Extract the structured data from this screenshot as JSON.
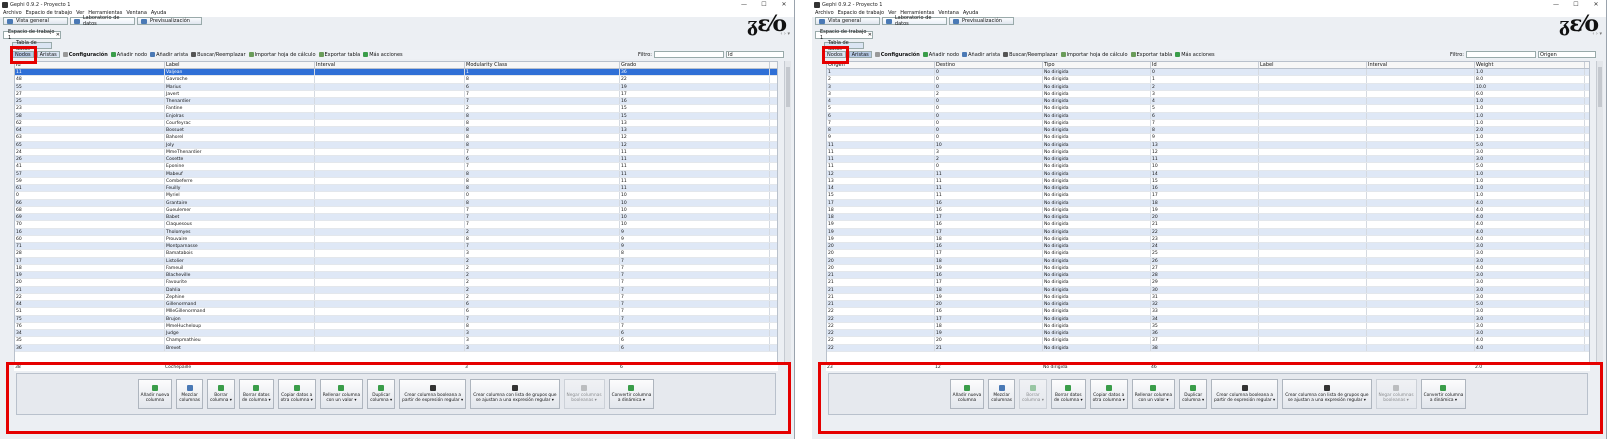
{
  "windows": [
    {
      "id": "left",
      "title": "Gephi 0.9.2 - Proyecto 1",
      "active_view": "Nodos",
      "columns": [
        "Id",
        "Label",
        "Interval",
        "Modularity Class",
        "Grado"
      ],
      "col_widths": [
        150,
        150,
        150,
        155,
        150
      ],
      "rows": [
        [
          "11",
          "Valjean",
          "",
          "1",
          "36"
        ],
        [
          "48",
          "Gavroche",
          "",
          "8",
          "22"
        ],
        [
          "55",
          "Marius",
          "",
          "6",
          "19"
        ],
        [
          "27",
          "Javert",
          "",
          "7",
          "17"
        ],
        [
          "25",
          "Thenardier",
          "",
          "7",
          "16"
        ],
        [
          "23",
          "Fantine",
          "",
          "2",
          "15"
        ],
        [
          "58",
          "Enjolras",
          "",
          "8",
          "15"
        ],
        [
          "62",
          "Courfeyrac",
          "",
          "8",
          "13"
        ],
        [
          "64",
          "Bossuet",
          "",
          "8",
          "13"
        ],
        [
          "63",
          "Bahorel",
          "",
          "8",
          "12"
        ],
        [
          "65",
          "Joly",
          "",
          "8",
          "12"
        ],
        [
          "24",
          "MmeThenardier",
          "",
          "7",
          "11"
        ],
        [
          "26",
          "Cosette",
          "",
          "6",
          "11"
        ],
        [
          "41",
          "Eponine",
          "",
          "7",
          "11"
        ],
        [
          "57",
          "Mabeuf",
          "",
          "8",
          "11"
        ],
        [
          "59",
          "Combeferre",
          "",
          "8",
          "11"
        ],
        [
          "61",
          "Feuilly",
          "",
          "8",
          "11"
        ],
        [
          "0",
          "Myriel",
          "",
          "0",
          "10"
        ],
        [
          "66",
          "Grantaire",
          "",
          "8",
          "10"
        ],
        [
          "68",
          "Gueulemer",
          "",
          "7",
          "10"
        ],
        [
          "69",
          "Babet",
          "",
          "7",
          "10"
        ],
        [
          "70",
          "Claquesous",
          "",
          "7",
          "10"
        ],
        [
          "16",
          "Tholomyes",
          "",
          "2",
          "9"
        ],
        [
          "60",
          "Prouvaire",
          "",
          "8",
          "9"
        ],
        [
          "71",
          "Montparnasse",
          "",
          "7",
          "9"
        ],
        [
          "28",
          "Bamatabois",
          "",
          "3",
          "8"
        ],
        [
          "17",
          "Listolier",
          "",
          "2",
          "7"
        ],
        [
          "18",
          "Fameuil",
          "",
          "2",
          "7"
        ],
        [
          "19",
          "Blacheville",
          "",
          "2",
          "7"
        ],
        [
          "20",
          "Favourite",
          "",
          "2",
          "7"
        ],
        [
          "21",
          "Dahlia",
          "",
          "2",
          "7"
        ],
        [
          "22",
          "Zephine",
          "",
          "2",
          "7"
        ],
        [
          "44",
          "Gillenormand",
          "",
          "6",
          "7"
        ],
        [
          "51",
          "MlleGillenormand",
          "",
          "6",
          "7"
        ],
        [
          "75",
          "Brujon",
          "",
          "7",
          "7"
        ],
        [
          "76",
          "MmeHucheloup",
          "",
          "8",
          "7"
        ],
        [
          "34",
          "Judge",
          "",
          "3",
          "6"
        ],
        [
          "35",
          "Champmathieu",
          "",
          "3",
          "6"
        ],
        [
          "36",
          "Brevet",
          "",
          "3",
          "6"
        ]
      ],
      "last_row": [
        "38",
        "Cochepaille",
        "",
        "3",
        "6"
      ]
    },
    {
      "id": "right",
      "title": "Gephi 0.9.2 - Proyecto 1",
      "active_view": "Aristas",
      "columns": [
        "Origen",
        "Destino",
        "Tipo",
        "Id",
        "Label",
        "Interval",
        "Weight"
      ],
      "col_widths": [
        108,
        108,
        108,
        108,
        108,
        108,
        110
      ],
      "rows": [
        [
          "1",
          "0",
          "No dirigida",
          "0",
          "",
          "",
          "1.0"
        ],
        [
          "2",
          "0",
          "No dirigida",
          "1",
          "",
          "",
          "8.0"
        ],
        [
          "3",
          "0",
          "No dirigida",
          "2",
          "",
          "",
          "10.0"
        ],
        [
          "3",
          "2",
          "No dirigida",
          "3",
          "",
          "",
          "6.0"
        ],
        [
          "4",
          "0",
          "No dirigida",
          "4",
          "",
          "",
          "1.0"
        ],
        [
          "5",
          "0",
          "No dirigida",
          "5",
          "",
          "",
          "1.0"
        ],
        [
          "6",
          "0",
          "No dirigida",
          "6",
          "",
          "",
          "1.0"
        ],
        [
          "7",
          "0",
          "No dirigida",
          "7",
          "",
          "",
          "1.0"
        ],
        [
          "8",
          "0",
          "No dirigida",
          "8",
          "",
          "",
          "2.0"
        ],
        [
          "9",
          "0",
          "No dirigida",
          "9",
          "",
          "",
          "1.0"
        ],
        [
          "11",
          "10",
          "No dirigida",
          "13",
          "",
          "",
          "5.0"
        ],
        [
          "11",
          "3",
          "No dirigida",
          "12",
          "",
          "",
          "3.0"
        ],
        [
          "11",
          "2",
          "No dirigida",
          "11",
          "",
          "",
          "3.0"
        ],
        [
          "11",
          "0",
          "No dirigida",
          "10",
          "",
          "",
          "5.0"
        ],
        [
          "12",
          "11",
          "No dirigida",
          "14",
          "",
          "",
          "1.0"
        ],
        [
          "13",
          "11",
          "No dirigida",
          "15",
          "",
          "",
          "1.0"
        ],
        [
          "14",
          "11",
          "No dirigida",
          "16",
          "",
          "",
          "1.0"
        ],
        [
          "15",
          "11",
          "No dirigida",
          "17",
          "",
          "",
          "1.0"
        ],
        [
          "17",
          "16",
          "No dirigida",
          "18",
          "",
          "",
          "4.0"
        ],
        [
          "18",
          "16",
          "No dirigida",
          "19",
          "",
          "",
          "4.0"
        ],
        [
          "18",
          "17",
          "No dirigida",
          "20",
          "",
          "",
          "4.0"
        ],
        [
          "19",
          "16",
          "No dirigida",
          "21",
          "",
          "",
          "4.0"
        ],
        [
          "19",
          "17",
          "No dirigida",
          "22",
          "",
          "",
          "4.0"
        ],
        [
          "19",
          "18",
          "No dirigida",
          "23",
          "",
          "",
          "4.0"
        ],
        [
          "20",
          "16",
          "No dirigida",
          "24",
          "",
          "",
          "3.0"
        ],
        [
          "20",
          "17",
          "No dirigida",
          "25",
          "",
          "",
          "3.0"
        ],
        [
          "20",
          "18",
          "No dirigida",
          "26",
          "",
          "",
          "3.0"
        ],
        [
          "20",
          "19",
          "No dirigida",
          "27",
          "",
          "",
          "4.0"
        ],
        [
          "21",
          "16",
          "No dirigida",
          "28",
          "",
          "",
          "3.0"
        ],
        [
          "21",
          "17",
          "No dirigida",
          "29",
          "",
          "",
          "3.0"
        ],
        [
          "21",
          "18",
          "No dirigida",
          "30",
          "",
          "",
          "3.0"
        ],
        [
          "21",
          "19",
          "No dirigida",
          "31",
          "",
          "",
          "3.0"
        ],
        [
          "21",
          "20",
          "No dirigida",
          "32",
          "",
          "",
          "5.0"
        ],
        [
          "22",
          "16",
          "No dirigida",
          "33",
          "",
          "",
          "3.0"
        ],
        [
          "22",
          "17",
          "No dirigida",
          "34",
          "",
          "",
          "3.0"
        ],
        [
          "22",
          "18",
          "No dirigida",
          "35",
          "",
          "",
          "3.0"
        ],
        [
          "22",
          "19",
          "No dirigida",
          "36",
          "",
          "",
          "3.0"
        ],
        [
          "22",
          "20",
          "No dirigida",
          "37",
          "",
          "",
          "4.0"
        ],
        [
          "22",
          "21",
          "No dirigida",
          "38",
          "",
          "",
          "4.0"
        ]
      ],
      "last_row": [
        "23",
        "12",
        "No dirigida",
        "46",
        "",
        "",
        "2.0"
      ]
    }
  ],
  "menu": [
    "Archivo",
    "Espacio de trabajo",
    "Ver",
    "Herramientas",
    "Ventana",
    "Ayuda"
  ],
  "perspectives": [
    "Vista general",
    "Laboratorio de datos",
    "Previsualización"
  ],
  "workspace_tab": "Espacio de trabajo 1",
  "panel_tab": "Tabla de datos",
  "toolbar": {
    "nodes": "Nodos",
    "edges": "Aristas",
    "config": "Configuración",
    "add_node": "Añadir nodo",
    "add_edge": "Añadir arista",
    "search_replace": "Buscar/Reemplazar",
    "import_sheet": "Importar hoja de cálculo",
    "export_table": "Exportar tabla",
    "more_actions": "Más acciones",
    "filter_label": "Filtro:"
  },
  "actions": [
    {
      "label": "Añadir nueva\ncolumna",
      "color": "#3a9d4a",
      "disabled": false
    },
    {
      "label": "Mezclar\ncolumnas",
      "color": "#4a79b5",
      "disabled": false
    },
    {
      "label": "Borrar\ncolumna ▾",
      "color": "#3a9d4a",
      "disabled": false
    },
    {
      "label": "Borrar datos\nde columna ▾",
      "color": "#3a9d4a",
      "disabled": false
    },
    {
      "label": "Copiar datos a\notra columna ▾",
      "color": "#3a9d4a",
      "disabled": false
    },
    {
      "label": "Rellenar columna\ncon un valor ▾",
      "color": "#3a9d4a",
      "disabled": false
    },
    {
      "label": "Duplicar\ncolumna ▾",
      "color": "#3a9d4a",
      "disabled": false
    },
    {
      "label": "Crear columna booleana a\npartir de expresión regular ▾",
      "color": "#333",
      "disabled": false
    },
    {
      "label": "Crear columna con lista de grupos que\nse ajustan a una expresión regular ▾",
      "color": "#333",
      "disabled": false
    },
    {
      "label": "Negar columnas\nbooleanas ▾",
      "color": "#888",
      "disabled": true
    },
    {
      "label": "Convertir columna\na dinámica ▾",
      "color": "#3a9d4a",
      "disabled": false
    }
  ],
  "right_filter_select": "Origen",
  "left_filter_select": "Id"
}
